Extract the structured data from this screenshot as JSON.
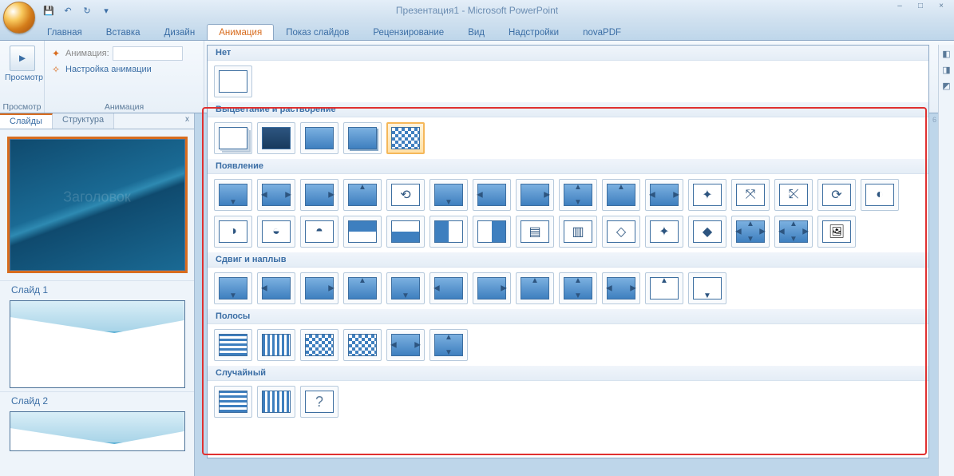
{
  "app": {
    "title_doc": "Презентация1",
    "title_app": "Microsoft PowerPoint"
  },
  "qat": {
    "save": "💾",
    "undo": "↶",
    "redo": "↻",
    "more": "▾"
  },
  "tabs": {
    "home": "Главная",
    "insert": "Вставка",
    "design": "Дизайн",
    "animation": "Анимация",
    "slideshow": "Показ слайдов",
    "review": "Рецензирование",
    "view": "Вид",
    "addins": "Надстройки",
    "novapdf": "novaPDF"
  },
  "ribbon": {
    "preview_btn": "Просмотр",
    "preview_group": "Просмотр",
    "anim_label": "Анимация:",
    "anim_setup": "Настройка анимации",
    "anim_group": "Анимация"
  },
  "gallery": {
    "cat_none": "Нет",
    "cat_fade": "Выцветание и растворение",
    "cat_appear": "Появление",
    "cat_push": "Сдвиг и наплыв",
    "cat_bars": "Полосы",
    "cat_random": "Случайный",
    "question": "?"
  },
  "leftpanel": {
    "slides_tab": "Слайды",
    "outline_tab": "Структура",
    "close": "x",
    "slide1": "Слайд 1",
    "slide2": "Слайд 2",
    "thumb_title": "Заголовок"
  },
  "ruler_tick": "6"
}
